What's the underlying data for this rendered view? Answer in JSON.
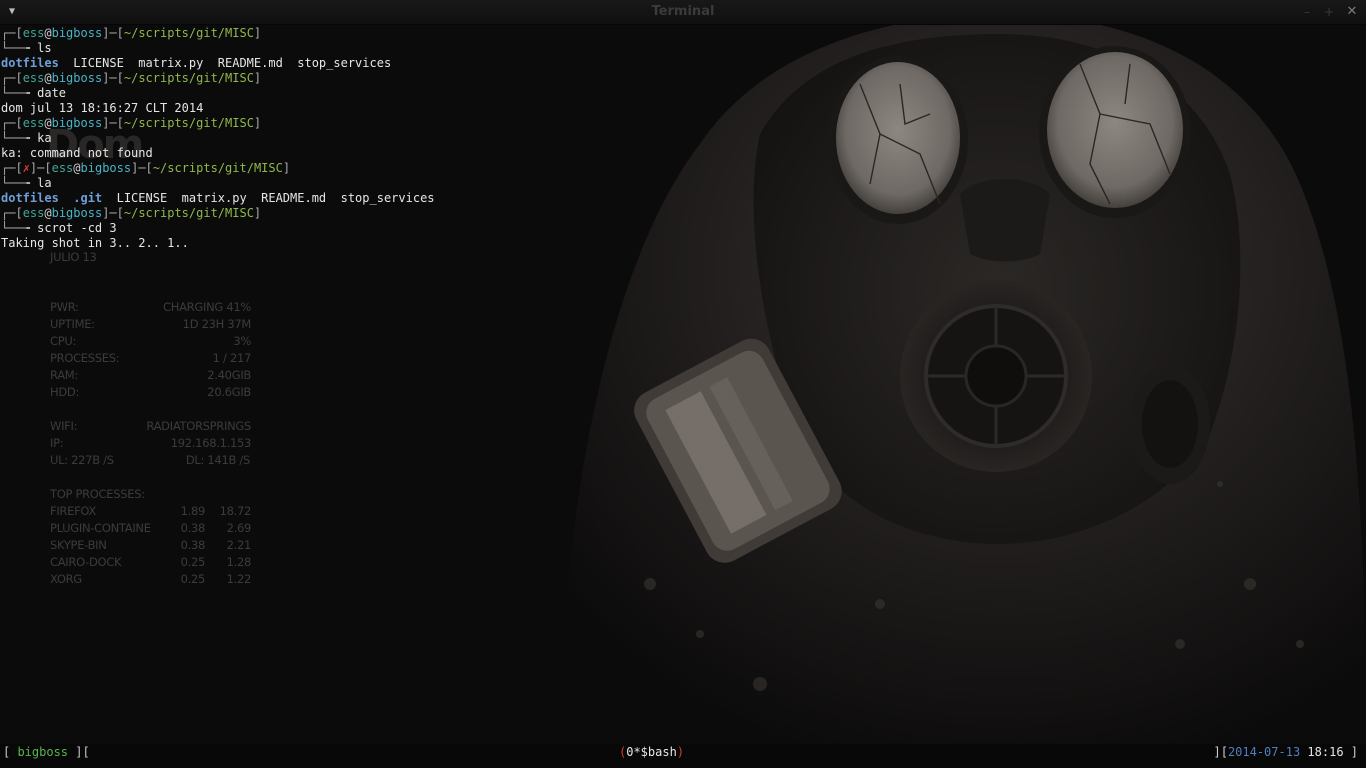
{
  "window": {
    "title": "Terminal",
    "buttons": {
      "minimize": "–",
      "maximize": "+",
      "close": "✕"
    }
  },
  "terminal": {
    "user": "ess",
    "host": "bigboss",
    "path": "~/scripts/git/MISC",
    "error_mark": "✗",
    "blocks": [
      {
        "command": "ls",
        "output_items": [
          "dotfiles",
          "LICENSE",
          "matrix.py",
          "README.md",
          "stop_services"
        ]
      },
      {
        "command": "date",
        "output_text": "dom jul 13 18:16:27 CLT 2014"
      },
      {
        "command": "ka",
        "output_text": "ka: command not found"
      },
      {
        "command": "la",
        "output_items": [
          "dotfiles",
          ".git",
          "LICENSE",
          "matrix.py",
          "README.md",
          "stop_services"
        ]
      },
      {
        "command": "scrot -cd 3",
        "output_text": "Taking shot in 3.. 2.. 1.."
      }
    ]
  },
  "conky": {
    "day_big": "Dom",
    "date_line": "JULIO 13",
    "system": [
      {
        "label": "PWR:",
        "value": "CHARGING 41%"
      },
      {
        "label": "UPTIME:",
        "value": "1D 23H 37M"
      },
      {
        "label": "CPU:",
        "value": "3%"
      },
      {
        "label": "PROCESSES:",
        "value": "1 / 217"
      },
      {
        "label": "RAM:",
        "value": "2.40GIB"
      },
      {
        "label": "HDD:",
        "value": "20.6GIB"
      }
    ],
    "network": {
      "wifi_label": "WIFI:",
      "wifi_value": "RADIATORSPRINGS",
      "ip_label": "IP:",
      "ip_value": "192.168.1.153",
      "ul": "UL: 227B  /S",
      "dl": "DL: 141B  /S"
    },
    "top_title": "TOP PROCESSES:",
    "top": [
      {
        "name": "FIREFOX",
        "cpu": "1.89",
        "mem": "18.72"
      },
      {
        "name": "PLUGIN-CONTAINE",
        "cpu": "0.38",
        "mem": "2.69"
      },
      {
        "name": "SKYPE-BIN",
        "cpu": "0.38",
        "mem": "2.21"
      },
      {
        "name": "CAIRO-DOCK",
        "cpu": "0.25",
        "mem": "1.28"
      },
      {
        "name": "XORG",
        "cpu": "0.25",
        "mem": "1.22"
      }
    ]
  },
  "statusbar": {
    "left_open": "[ ",
    "session": "bigboss",
    "left_close": " ][",
    "window_prefix": "(",
    "window_label": "0*$bash",
    "window_suffix": ")",
    "right_open": "][",
    "date": "2014-07-13",
    "time": "18:16",
    "right_close": " ]"
  }
}
